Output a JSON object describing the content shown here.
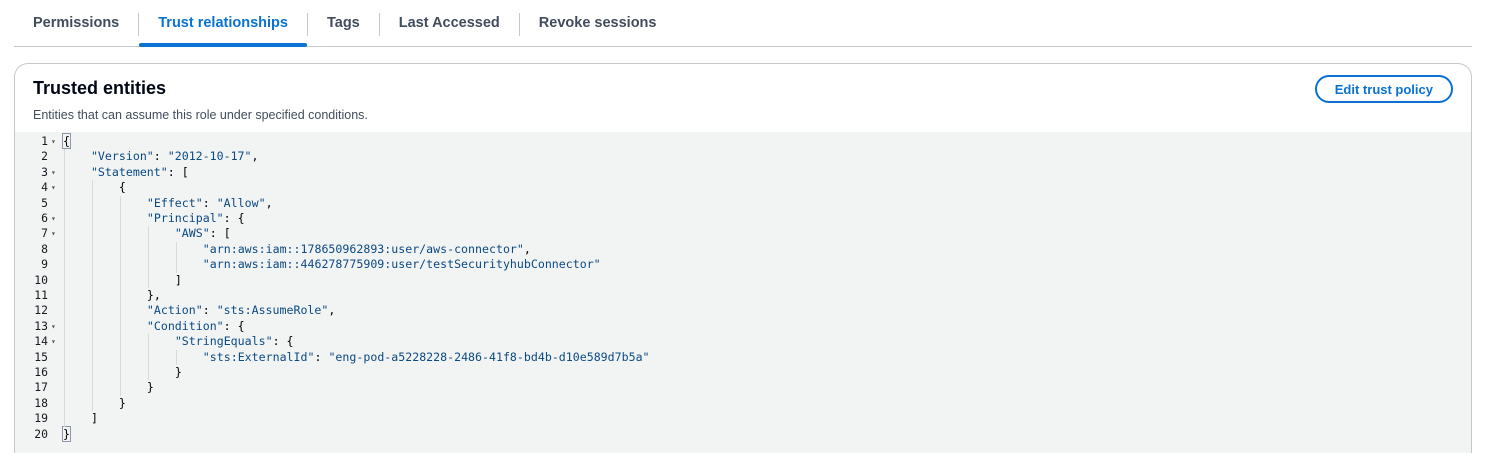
{
  "tabs": [
    {
      "label": "Permissions",
      "active": false
    },
    {
      "label": "Trust relationships",
      "active": true
    },
    {
      "label": "Tags",
      "active": false
    },
    {
      "label": "Last Accessed",
      "active": false
    },
    {
      "label": "Revoke sessions",
      "active": false
    }
  ],
  "panel": {
    "title": "Trusted entities",
    "description": "Entities that can assume this role under specified conditions.",
    "edit_button_label": "Edit trust policy"
  },
  "editor": {
    "lines": [
      {
        "n": "1",
        "fold": true,
        "indent": 0,
        "tokens": [
          [
            "p",
            "{"
          ]
        ]
      },
      {
        "n": "2",
        "fold": false,
        "indent": 1,
        "tokens": [
          [
            "k",
            "\"Version\""
          ],
          [
            "p",
            ": "
          ],
          [
            "s",
            "\"2012-10-17\""
          ],
          [
            "p",
            ","
          ]
        ]
      },
      {
        "n": "3",
        "fold": true,
        "indent": 1,
        "tokens": [
          [
            "k",
            "\"Statement\""
          ],
          [
            "p",
            ": ["
          ]
        ]
      },
      {
        "n": "4",
        "fold": true,
        "indent": 2,
        "tokens": [
          [
            "p",
            "{"
          ]
        ]
      },
      {
        "n": "5",
        "fold": false,
        "indent": 3,
        "tokens": [
          [
            "k",
            "\"Effect\""
          ],
          [
            "p",
            ": "
          ],
          [
            "s",
            "\"Allow\""
          ],
          [
            "p",
            ","
          ]
        ]
      },
      {
        "n": "6",
        "fold": true,
        "indent": 3,
        "tokens": [
          [
            "k",
            "\"Principal\""
          ],
          [
            "p",
            ": {"
          ]
        ]
      },
      {
        "n": "7",
        "fold": true,
        "indent": 4,
        "tokens": [
          [
            "k",
            "\"AWS\""
          ],
          [
            "p",
            ": ["
          ]
        ]
      },
      {
        "n": "8",
        "fold": false,
        "indent": 5,
        "tokens": [
          [
            "s",
            "\"arn:aws:iam::178650962893:user/aws-connector\""
          ],
          [
            "p",
            ","
          ]
        ]
      },
      {
        "n": "9",
        "fold": false,
        "indent": 5,
        "tokens": [
          [
            "s",
            "\"arn:aws:iam::446278775909:user/testSecurityhubConnector\""
          ]
        ]
      },
      {
        "n": "10",
        "fold": false,
        "indent": 4,
        "tokens": [
          [
            "p",
            "]"
          ]
        ]
      },
      {
        "n": "11",
        "fold": false,
        "indent": 3,
        "tokens": [
          [
            "p",
            "},"
          ]
        ]
      },
      {
        "n": "12",
        "fold": false,
        "indent": 3,
        "tokens": [
          [
            "k",
            "\"Action\""
          ],
          [
            "p",
            ": "
          ],
          [
            "s",
            "\"sts:AssumeRole\""
          ],
          [
            "p",
            ","
          ]
        ]
      },
      {
        "n": "13",
        "fold": true,
        "indent": 3,
        "tokens": [
          [
            "k",
            "\"Condition\""
          ],
          [
            "p",
            ": {"
          ]
        ]
      },
      {
        "n": "14",
        "fold": true,
        "indent": 4,
        "tokens": [
          [
            "k",
            "\"StringEquals\""
          ],
          [
            "p",
            ": {"
          ]
        ]
      },
      {
        "n": "15",
        "fold": false,
        "indent": 5,
        "tokens": [
          [
            "k",
            "\"sts:ExternalId\""
          ],
          [
            "p",
            ": "
          ],
          [
            "s",
            "\"eng-pod-a5228228-2486-41f8-bd4b-d10e589d7b5a\""
          ]
        ]
      },
      {
        "n": "16",
        "fold": false,
        "indent": 4,
        "tokens": [
          [
            "p",
            "}"
          ]
        ]
      },
      {
        "n": "17",
        "fold": false,
        "indent": 3,
        "tokens": [
          [
            "p",
            "}"
          ]
        ]
      },
      {
        "n": "18",
        "fold": false,
        "indent": 2,
        "tokens": [
          [
            "p",
            "}"
          ]
        ]
      },
      {
        "n": "19",
        "fold": false,
        "indent": 1,
        "tokens": [
          [
            "p",
            "]"
          ]
        ]
      },
      {
        "n": "20",
        "fold": false,
        "indent": 0,
        "tokens": [
          [
            "p",
            "}"
          ]
        ]
      }
    ]
  },
  "icons": {
    "fold": "caret-down-icon"
  },
  "colors": {
    "accent": "#0972d3",
    "editor_bg": "#f2f3f3",
    "code_key": "#0a4a85"
  }
}
